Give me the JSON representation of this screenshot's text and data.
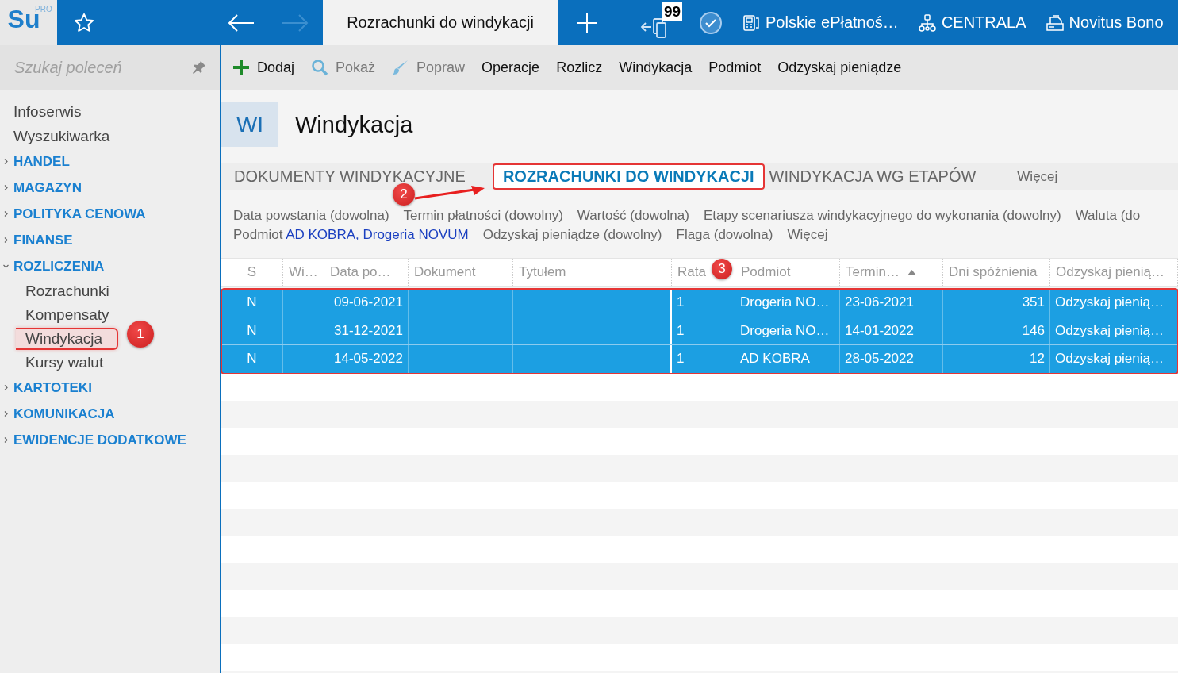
{
  "app": {
    "logo": "Su",
    "logo_tag": "PRO"
  },
  "topbar": {
    "open_tab": "Rozrachunki do windykacji",
    "badge": "99",
    "items": [
      {
        "kind": "terminal",
        "label": "Polskie ePłatnoś…"
      },
      {
        "kind": "network",
        "label": "CENTRALA"
      },
      {
        "kind": "printer",
        "label": "Novitus Bono"
      }
    ]
  },
  "sidebar": {
    "search": {
      "placeholder": "Szukaj poleceń"
    },
    "items": [
      {
        "kind": "link",
        "label": "Infoserwis"
      },
      {
        "kind": "link",
        "label": "Wyszukiwarka"
      },
      {
        "kind": "section",
        "label": "HANDEL",
        "expanded": false
      },
      {
        "kind": "section",
        "label": "MAGAZYN",
        "expanded": false
      },
      {
        "kind": "section",
        "label": "POLITYKA CENOWA",
        "expanded": false
      },
      {
        "kind": "section",
        "label": "FINANSE",
        "expanded": false
      },
      {
        "kind": "section",
        "label": "ROZLICZENIA",
        "expanded": true,
        "children": [
          {
            "label": "Rozrachunki",
            "selected": false,
            "highlighted": false
          },
          {
            "label": "Kompensaty",
            "selected": false,
            "highlighted": false
          },
          {
            "label": "Windykacja",
            "selected": true,
            "highlighted": true
          },
          {
            "label": "Kursy walut",
            "selected": false,
            "highlighted": false
          }
        ]
      },
      {
        "kind": "section",
        "label": "KARTOTEKI",
        "expanded": false
      },
      {
        "kind": "section",
        "label": "KOMUNIKACJA",
        "expanded": false
      },
      {
        "kind": "section",
        "label": "EWIDENCJE DODATKOWE",
        "expanded": false
      }
    ]
  },
  "toolbar": [
    {
      "kind": "add",
      "label": "Dodaj",
      "disabled": false
    },
    {
      "kind": "view",
      "label": "Pokaż",
      "disabled": true
    },
    {
      "kind": "edit",
      "label": "Popraw",
      "disabled": true
    },
    {
      "kind": "plain",
      "label": "Operacje",
      "disabled": false
    },
    {
      "kind": "plain",
      "label": "Rozlicz",
      "disabled": false
    },
    {
      "kind": "plain",
      "label": "Windykacja",
      "disabled": false
    },
    {
      "kind": "plain",
      "label": "Podmiot",
      "disabled": false
    },
    {
      "kind": "plain",
      "label": "Odzyskaj pieniądze",
      "disabled": false
    }
  ],
  "header": {
    "code": "WI",
    "title": "Windykacja"
  },
  "tabs": [
    {
      "label": "DOKUMENTY WINDYKACYJNE",
      "selected": false,
      "highlighted": false
    },
    {
      "label": "ROZRACHUNKI DO WINDYKACJI",
      "selected": true,
      "highlighted": true
    },
    {
      "label": "WINDYKACJA WG ETAPÓW",
      "selected": false,
      "highlighted": false
    },
    {
      "label": "Więcej",
      "selected": false,
      "highlighted": false,
      "kind": "more"
    }
  ],
  "filters": [
    [
      {
        "label": "Data powstania (dowolna)"
      },
      {
        "label": "Termin płatności (dowolny)"
      },
      {
        "label": "Wartość (dowolna)"
      },
      {
        "label": "Etapy scenariusza windykacyjnego do wykonania (dowolny)"
      },
      {
        "label": "Waluta (do"
      }
    ],
    [
      {
        "label": "Podmiot",
        "value": "AD KOBRA, Drogeria NOVUM"
      },
      {
        "label": "Odzyskaj pieniądze (dowolny)"
      },
      {
        "label": "Flaga (dowolna)"
      },
      {
        "label": "Więcej"
      }
    ]
  ],
  "table": {
    "highlighted": true,
    "columns": [
      {
        "label": "S"
      },
      {
        "label": "Wi…"
      },
      {
        "label": "Data po…"
      },
      {
        "label": "Dokument"
      },
      {
        "label": "Tytułem"
      },
      {
        "label": "Rata"
      },
      {
        "label": "Podmiot"
      },
      {
        "label": "Termin…",
        "sorted": true
      },
      {
        "label": "Dni spóźnienia"
      },
      {
        "label": "Odzyskaj pienią…"
      }
    ],
    "rows": [
      {
        "selected": true,
        "cells": [
          "N",
          null,
          "09-06-2021",
          null,
          null,
          "1",
          "Drogeria NO…",
          "23-06-2021",
          "351",
          "Odzyskaj pienią…"
        ]
      },
      {
        "selected": true,
        "cells": [
          "N",
          null,
          "31-12-2021",
          null,
          null,
          "1",
          "Drogeria NO…",
          "14-01-2022",
          "146",
          "Odzyskaj pienią…"
        ]
      },
      {
        "selected": true,
        "cells": [
          "N",
          null,
          "14-05-2022",
          null,
          null,
          "1",
          "AD KOBRA",
          "28-05-2022",
          "12",
          "Odzyskaj pienią…"
        ]
      }
    ]
  },
  "annotations": [
    {
      "kind": "badge",
      "label": "1"
    },
    {
      "kind": "badge",
      "label": "2"
    },
    {
      "kind": "arrow"
    },
    {
      "kind": "badge",
      "label": "3"
    }
  ]
}
